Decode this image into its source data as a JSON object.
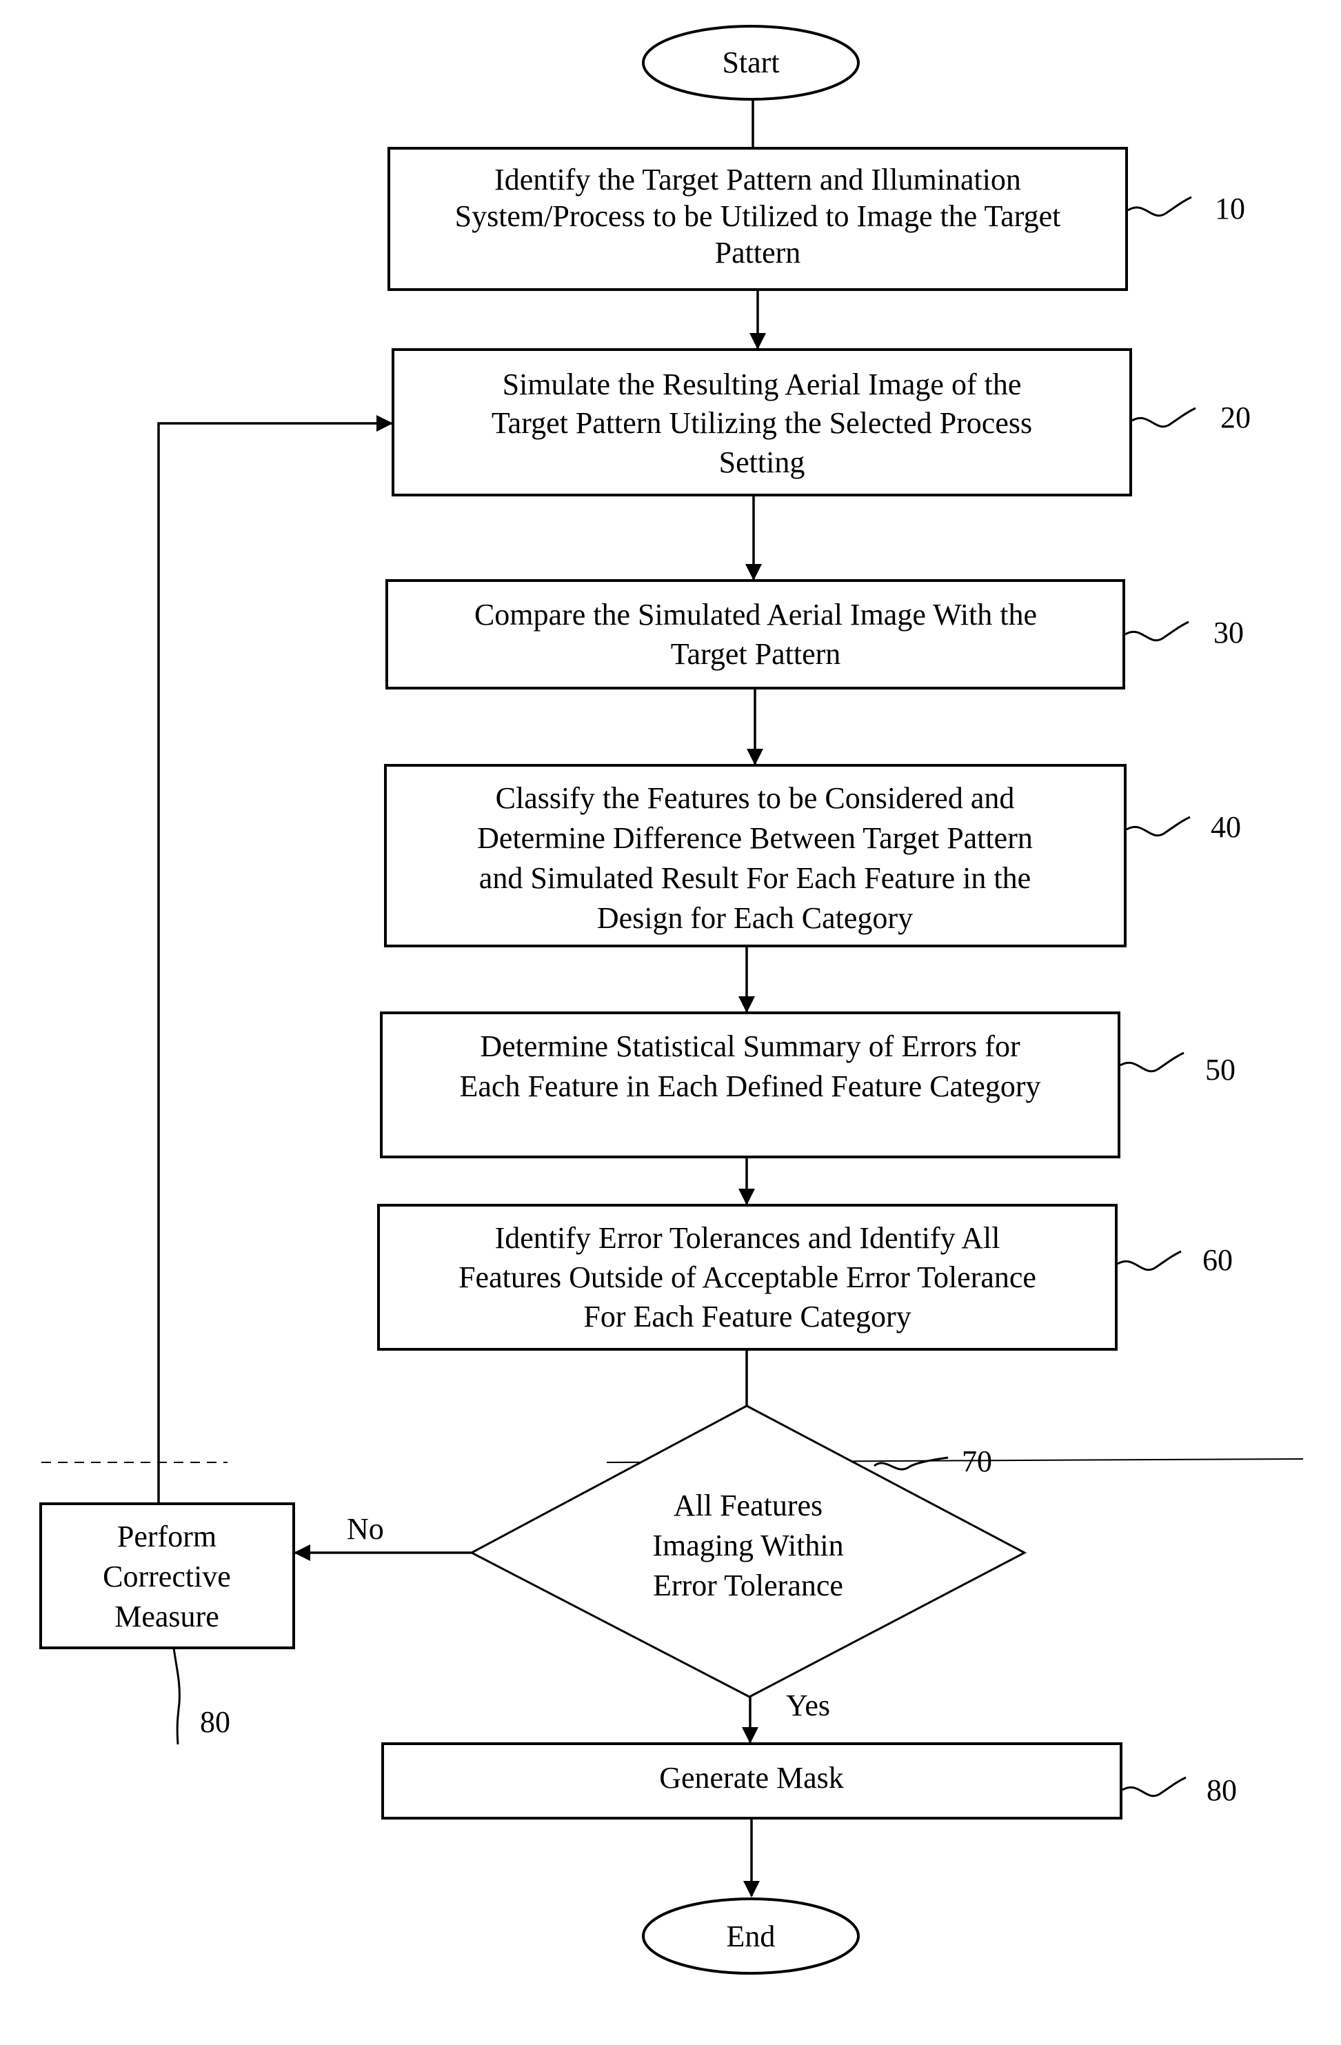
{
  "diagram": {
    "type": "flowchart",
    "start": {
      "label": "Start"
    },
    "end": {
      "label": "End"
    },
    "steps": [
      {
        "id": "10",
        "ref": "10",
        "lines": [
          "Identify the Target Pattern and Illumination",
          "System/Process to be Utilized to Image the Target",
          "Pattern"
        ]
      },
      {
        "id": "20",
        "ref": "20",
        "lines": [
          "Simulate the Resulting Aerial Image of the",
          "Target Pattern Utilizing the Selected Process",
          "Setting"
        ]
      },
      {
        "id": "30",
        "ref": "30",
        "lines": [
          "Compare the Simulated Aerial Image With the",
          "Target Pattern"
        ]
      },
      {
        "id": "40",
        "ref": "40",
        "lines": [
          "Classify the Features to be Considered and",
          "Determine Difference Between Target Pattern",
          "and Simulated Result For Each Feature in the",
          "Design for Each Category"
        ]
      },
      {
        "id": "50",
        "ref": "50",
        "lines": [
          "Determine Statistical Summary of Errors for",
          "Each Feature in Each Defined Feature Category"
        ]
      },
      {
        "id": "60",
        "ref": "60",
        "lines": [
          "Identify Error Tolerances and Identify All",
          "Features Outside of Acceptable Error Tolerance",
          "For Each Feature Category"
        ]
      }
    ],
    "decision": {
      "id": "70",
      "ref": "70",
      "lines": [
        "All Features",
        "Imaging Within",
        "Error Tolerance"
      ],
      "no_label": "No",
      "yes_label": "Yes"
    },
    "corrective": {
      "ref": "80",
      "lines": [
        "Perform",
        "Corrective",
        "Measure"
      ]
    },
    "generate": {
      "ref": "80",
      "lines": [
        "Generate Mask"
      ]
    }
  }
}
